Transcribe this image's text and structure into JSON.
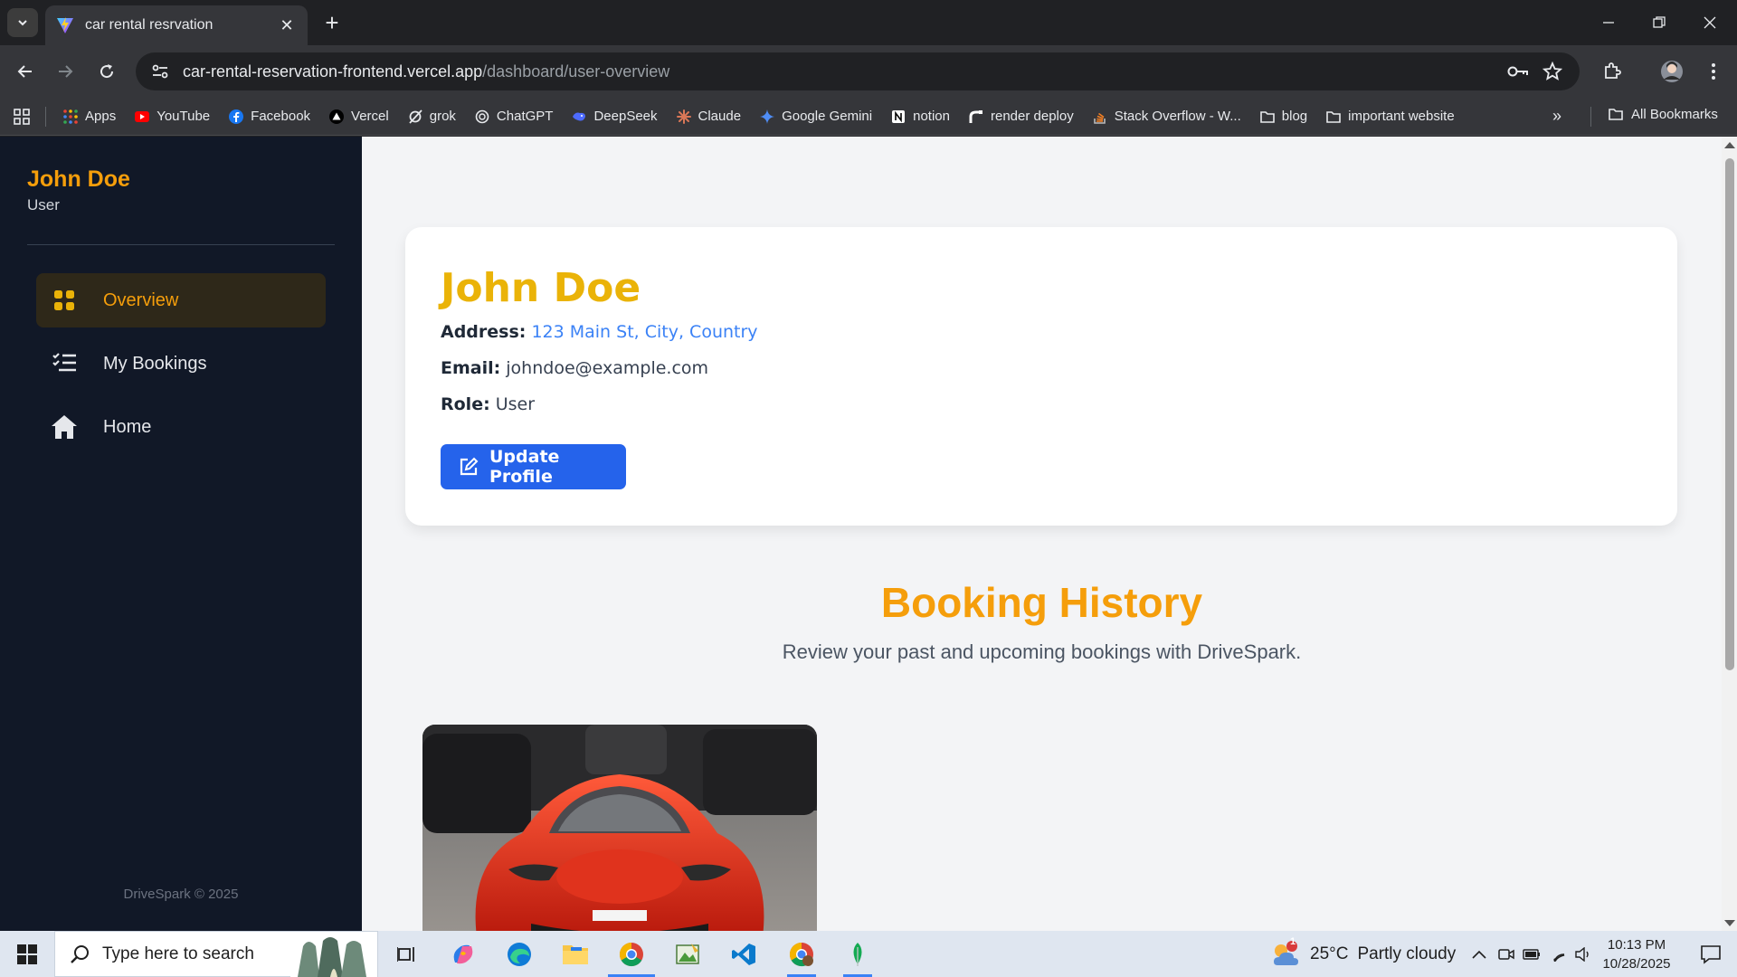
{
  "browser": {
    "tab_title": "car rental resrvation",
    "url_host": "car-rental-reservation-frontend.vercel.app",
    "url_path": "/dashboard/user-overview",
    "bookmarks": [
      {
        "label": "Apps",
        "icon": "apps-grid-icon",
        "color": "#ea4335"
      },
      {
        "label": "YouTube",
        "icon": "youtube-icon",
        "color": "#ff0000"
      },
      {
        "label": "Facebook",
        "icon": "facebook-icon",
        "color": "#1877f2"
      },
      {
        "label": "Vercel",
        "icon": "vercel-icon",
        "color": "#ffffff"
      },
      {
        "label": "grok",
        "icon": "grok-icon",
        "color": "#e8eaed"
      },
      {
        "label": "ChatGPT",
        "icon": "chatgpt-icon",
        "color": "#e8eaed"
      },
      {
        "label": "DeepSeek",
        "icon": "deepseek-icon",
        "color": "#4d6bfe"
      },
      {
        "label": "Claude",
        "icon": "claude-icon",
        "color": "#d97757"
      },
      {
        "label": "Google Gemini",
        "icon": "gemini-icon",
        "color": "#4f8df5"
      },
      {
        "label": "notion",
        "icon": "notion-icon",
        "color": "#ffffff"
      },
      {
        "label": "render deploy",
        "icon": "render-icon",
        "color": "#ffffff"
      },
      {
        "label": "Stack Overflow - W...",
        "icon": "stackoverflow-icon",
        "color": "#f48024"
      },
      {
        "label": "blog",
        "icon": "folder-icon",
        "color": "#e8eaed"
      },
      {
        "label": "important website",
        "icon": "folder-icon",
        "color": "#e8eaed"
      }
    ],
    "all_bookmarks": "All Bookmarks"
  },
  "sidebar": {
    "user_name": "John Doe",
    "user_role": "User",
    "nav": [
      {
        "label": "Overview",
        "icon": "grid-icon"
      },
      {
        "label": "My Bookings",
        "icon": "list-check-icon"
      },
      {
        "label": "Home",
        "icon": "home-icon"
      }
    ],
    "footer": "DriveSpark © 2025"
  },
  "profile": {
    "name": "John Doe",
    "address_label": "Address:",
    "address_value": "123 Main St, City, Country",
    "email_label": "Email:",
    "email_value": "johndoe@example.com",
    "role_label": "Role:",
    "role_value": "User",
    "update_button": "Update Profile"
  },
  "booking_history": {
    "title": "Booking History",
    "subtitle": "Review your past and upcoming bookings with DriveSpark."
  },
  "taskbar": {
    "search_placeholder": "Type here to search",
    "weather_temp": "25°C",
    "weather_desc": "Partly cloudy",
    "weather_badge": "1",
    "time": "10:13 PM",
    "date": "10/28/2025"
  },
  "colors": {
    "accent": "#f59e0b",
    "sidebar_bg": "#111827",
    "primary_button": "#2563eb",
    "link": "#3b82f6"
  }
}
